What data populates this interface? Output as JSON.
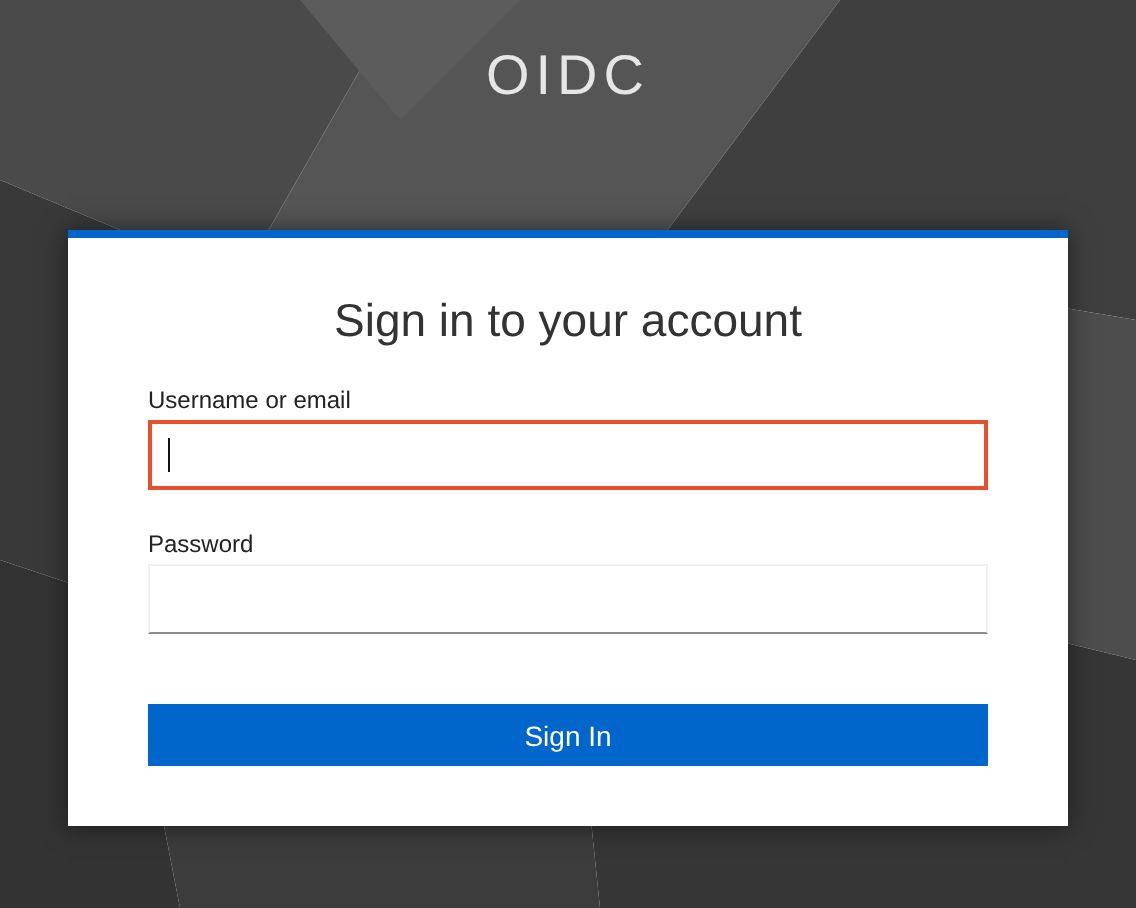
{
  "brand": "OIDC",
  "card": {
    "heading": "Sign in to your account",
    "fields": [
      {
        "label": "Username or email",
        "focused": true
      },
      {
        "label": "Password",
        "focused": false
      }
    ],
    "button": "Sign In"
  }
}
